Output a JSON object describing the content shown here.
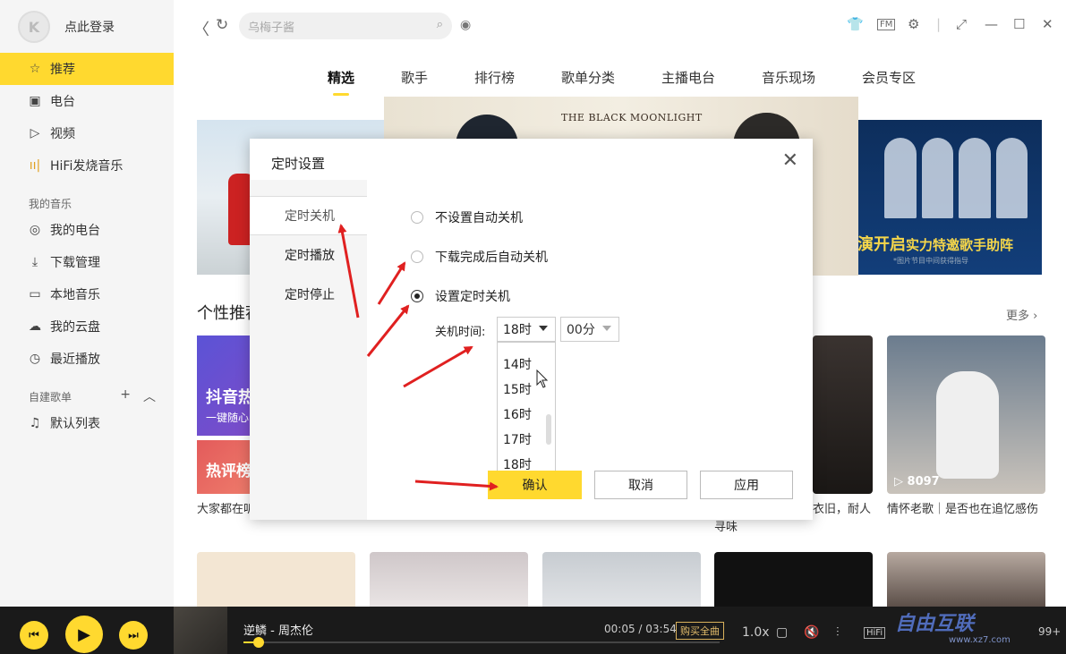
{
  "sidebar": {
    "login": "点此登录",
    "items": [
      {
        "label": "推荐",
        "icon": "star-icon"
      },
      {
        "label": "电台",
        "icon": "radio-icon"
      },
      {
        "label": "视频",
        "icon": "video-icon"
      },
      {
        "label": "HiFi发烧音乐",
        "icon": "hifi-icon"
      }
    ],
    "my_music_title": "我的音乐",
    "my_music": [
      {
        "label": "我的电台",
        "icon": "my-radio-icon"
      },
      {
        "label": "下载管理",
        "icon": "download-icon"
      },
      {
        "label": "本地音乐",
        "icon": "monitor-icon"
      },
      {
        "label": "我的云盘",
        "icon": "cloud-icon"
      },
      {
        "label": "最近播放",
        "icon": "clock-icon"
      }
    ],
    "playlist_title": "自建歌单",
    "playlists": [
      {
        "label": "默认列表",
        "icon": "playlist-icon"
      }
    ]
  },
  "topbar": {
    "search_placeholder": "乌梅子酱"
  },
  "tabs": [
    "精选",
    "歌手",
    "排行榜",
    "歌单分类",
    "主播电台",
    "音乐现场",
    "会员专区"
  ],
  "banner": {
    "center_title": "THE BLACK MOONLIGHT",
    "right_text": "演开启",
    "right_text2": "实力特邀歌手助阵",
    "right_sub": "*图片节目中间获得指导"
  },
  "recommend": {
    "title": "个性推荐",
    "more": "更多",
    "card2_title": "抖音热",
    "card2_sub": "一键随心",
    "card2b_title": "热评榜",
    "card2_caption": "大家都在听",
    "card4_caption": "衣旧，耐人寻味",
    "card5_plays": "8097",
    "card5_caption": "情怀老歌｜是否也在追忆感伤"
  },
  "dialog": {
    "title": "定时设置",
    "side": [
      "定时关机",
      "定时播放",
      "定时停止"
    ],
    "options": [
      "不设置自动关机",
      "下载完成后自动关机",
      "设置定时关机"
    ],
    "selected_option": 2,
    "time_label": "关机时间:",
    "hour": "18时",
    "minute": "00分",
    "hour_options": [
      "14时",
      "15时",
      "16时",
      "17时",
      "18时"
    ],
    "buttons": {
      "confirm": "确认",
      "cancel": "取消",
      "apply": "应用"
    }
  },
  "player": {
    "song": "逆鳞 - 周杰伦",
    "time": "00:05 / 03:54",
    "buy": "购买全曲",
    "speed": "1.0x",
    "hifi": "HiFi",
    "count": "99+",
    "progress": 0.021
  },
  "watermark": {
    "text": "自由互联",
    "url": "www.xz7.com"
  },
  "colors": {
    "accent": "#ffd92f",
    "player_bg": "#1a1a1a",
    "arrow": "#e02020"
  }
}
